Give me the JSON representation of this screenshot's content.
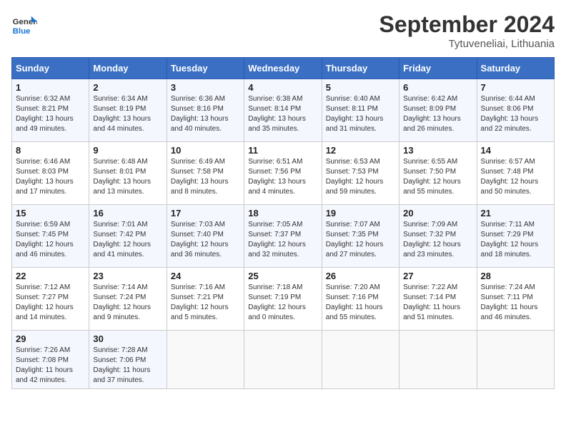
{
  "header": {
    "logo_line1": "General",
    "logo_line2": "Blue",
    "month_title": "September 2024",
    "subtitle": "Tytuveneliai, Lithuania"
  },
  "days_of_week": [
    "Sunday",
    "Monday",
    "Tuesday",
    "Wednesday",
    "Thursday",
    "Friday",
    "Saturday"
  ],
  "weeks": [
    [
      {
        "day": "1",
        "sunrise": "Sunrise: 6:32 AM",
        "sunset": "Sunset: 8:21 PM",
        "daylight": "Daylight: 13 hours and 49 minutes."
      },
      {
        "day": "2",
        "sunrise": "Sunrise: 6:34 AM",
        "sunset": "Sunset: 8:19 PM",
        "daylight": "Daylight: 13 hours and 44 minutes."
      },
      {
        "day": "3",
        "sunrise": "Sunrise: 6:36 AM",
        "sunset": "Sunset: 8:16 PM",
        "daylight": "Daylight: 13 hours and 40 minutes."
      },
      {
        "day": "4",
        "sunrise": "Sunrise: 6:38 AM",
        "sunset": "Sunset: 8:14 PM",
        "daylight": "Daylight: 13 hours and 35 minutes."
      },
      {
        "day": "5",
        "sunrise": "Sunrise: 6:40 AM",
        "sunset": "Sunset: 8:11 PM",
        "daylight": "Daylight: 13 hours and 31 minutes."
      },
      {
        "day": "6",
        "sunrise": "Sunrise: 6:42 AM",
        "sunset": "Sunset: 8:09 PM",
        "daylight": "Daylight: 13 hours and 26 minutes."
      },
      {
        "day": "7",
        "sunrise": "Sunrise: 6:44 AM",
        "sunset": "Sunset: 8:06 PM",
        "daylight": "Daylight: 13 hours and 22 minutes."
      }
    ],
    [
      {
        "day": "8",
        "sunrise": "Sunrise: 6:46 AM",
        "sunset": "Sunset: 8:03 PM",
        "daylight": "Daylight: 13 hours and 17 minutes."
      },
      {
        "day": "9",
        "sunrise": "Sunrise: 6:48 AM",
        "sunset": "Sunset: 8:01 PM",
        "daylight": "Daylight: 13 hours and 13 minutes."
      },
      {
        "day": "10",
        "sunrise": "Sunrise: 6:49 AM",
        "sunset": "Sunset: 7:58 PM",
        "daylight": "Daylight: 13 hours and 8 minutes."
      },
      {
        "day": "11",
        "sunrise": "Sunrise: 6:51 AM",
        "sunset": "Sunset: 7:56 PM",
        "daylight": "Daylight: 13 hours and 4 minutes."
      },
      {
        "day": "12",
        "sunrise": "Sunrise: 6:53 AM",
        "sunset": "Sunset: 7:53 PM",
        "daylight": "Daylight: 12 hours and 59 minutes."
      },
      {
        "day": "13",
        "sunrise": "Sunrise: 6:55 AM",
        "sunset": "Sunset: 7:50 PM",
        "daylight": "Daylight: 12 hours and 55 minutes."
      },
      {
        "day": "14",
        "sunrise": "Sunrise: 6:57 AM",
        "sunset": "Sunset: 7:48 PM",
        "daylight": "Daylight: 12 hours and 50 minutes."
      }
    ],
    [
      {
        "day": "15",
        "sunrise": "Sunrise: 6:59 AM",
        "sunset": "Sunset: 7:45 PM",
        "daylight": "Daylight: 12 hours and 46 minutes."
      },
      {
        "day": "16",
        "sunrise": "Sunrise: 7:01 AM",
        "sunset": "Sunset: 7:42 PM",
        "daylight": "Daylight: 12 hours and 41 minutes."
      },
      {
        "day": "17",
        "sunrise": "Sunrise: 7:03 AM",
        "sunset": "Sunset: 7:40 PM",
        "daylight": "Daylight: 12 hours and 36 minutes."
      },
      {
        "day": "18",
        "sunrise": "Sunrise: 7:05 AM",
        "sunset": "Sunset: 7:37 PM",
        "daylight": "Daylight: 12 hours and 32 minutes."
      },
      {
        "day": "19",
        "sunrise": "Sunrise: 7:07 AM",
        "sunset": "Sunset: 7:35 PM",
        "daylight": "Daylight: 12 hours and 27 minutes."
      },
      {
        "day": "20",
        "sunrise": "Sunrise: 7:09 AM",
        "sunset": "Sunset: 7:32 PM",
        "daylight": "Daylight: 12 hours and 23 minutes."
      },
      {
        "day": "21",
        "sunrise": "Sunrise: 7:11 AM",
        "sunset": "Sunset: 7:29 PM",
        "daylight": "Daylight: 12 hours and 18 minutes."
      }
    ],
    [
      {
        "day": "22",
        "sunrise": "Sunrise: 7:12 AM",
        "sunset": "Sunset: 7:27 PM",
        "daylight": "Daylight: 12 hours and 14 minutes."
      },
      {
        "day": "23",
        "sunrise": "Sunrise: 7:14 AM",
        "sunset": "Sunset: 7:24 PM",
        "daylight": "Daylight: 12 hours and 9 minutes."
      },
      {
        "day": "24",
        "sunrise": "Sunrise: 7:16 AM",
        "sunset": "Sunset: 7:21 PM",
        "daylight": "Daylight: 12 hours and 5 minutes."
      },
      {
        "day": "25",
        "sunrise": "Sunrise: 7:18 AM",
        "sunset": "Sunset: 7:19 PM",
        "daylight": "Daylight: 12 hours and 0 minutes."
      },
      {
        "day": "26",
        "sunrise": "Sunrise: 7:20 AM",
        "sunset": "Sunset: 7:16 PM",
        "daylight": "Daylight: 11 hours and 55 minutes."
      },
      {
        "day": "27",
        "sunrise": "Sunrise: 7:22 AM",
        "sunset": "Sunset: 7:14 PM",
        "daylight": "Daylight: 11 hours and 51 minutes."
      },
      {
        "day": "28",
        "sunrise": "Sunrise: 7:24 AM",
        "sunset": "Sunset: 7:11 PM",
        "daylight": "Daylight: 11 hours and 46 minutes."
      }
    ],
    [
      {
        "day": "29",
        "sunrise": "Sunrise: 7:26 AM",
        "sunset": "Sunset: 7:08 PM",
        "daylight": "Daylight: 11 hours and 42 minutes."
      },
      {
        "day": "30",
        "sunrise": "Sunrise: 7:28 AM",
        "sunset": "Sunset: 7:06 PM",
        "daylight": "Daylight: 11 hours and 37 minutes."
      },
      {
        "day": "",
        "sunrise": "",
        "sunset": "",
        "daylight": ""
      },
      {
        "day": "",
        "sunrise": "",
        "sunset": "",
        "daylight": ""
      },
      {
        "day": "",
        "sunrise": "",
        "sunset": "",
        "daylight": ""
      },
      {
        "day": "",
        "sunrise": "",
        "sunset": "",
        "daylight": ""
      },
      {
        "day": "",
        "sunrise": "",
        "sunset": "",
        "daylight": ""
      }
    ]
  ]
}
